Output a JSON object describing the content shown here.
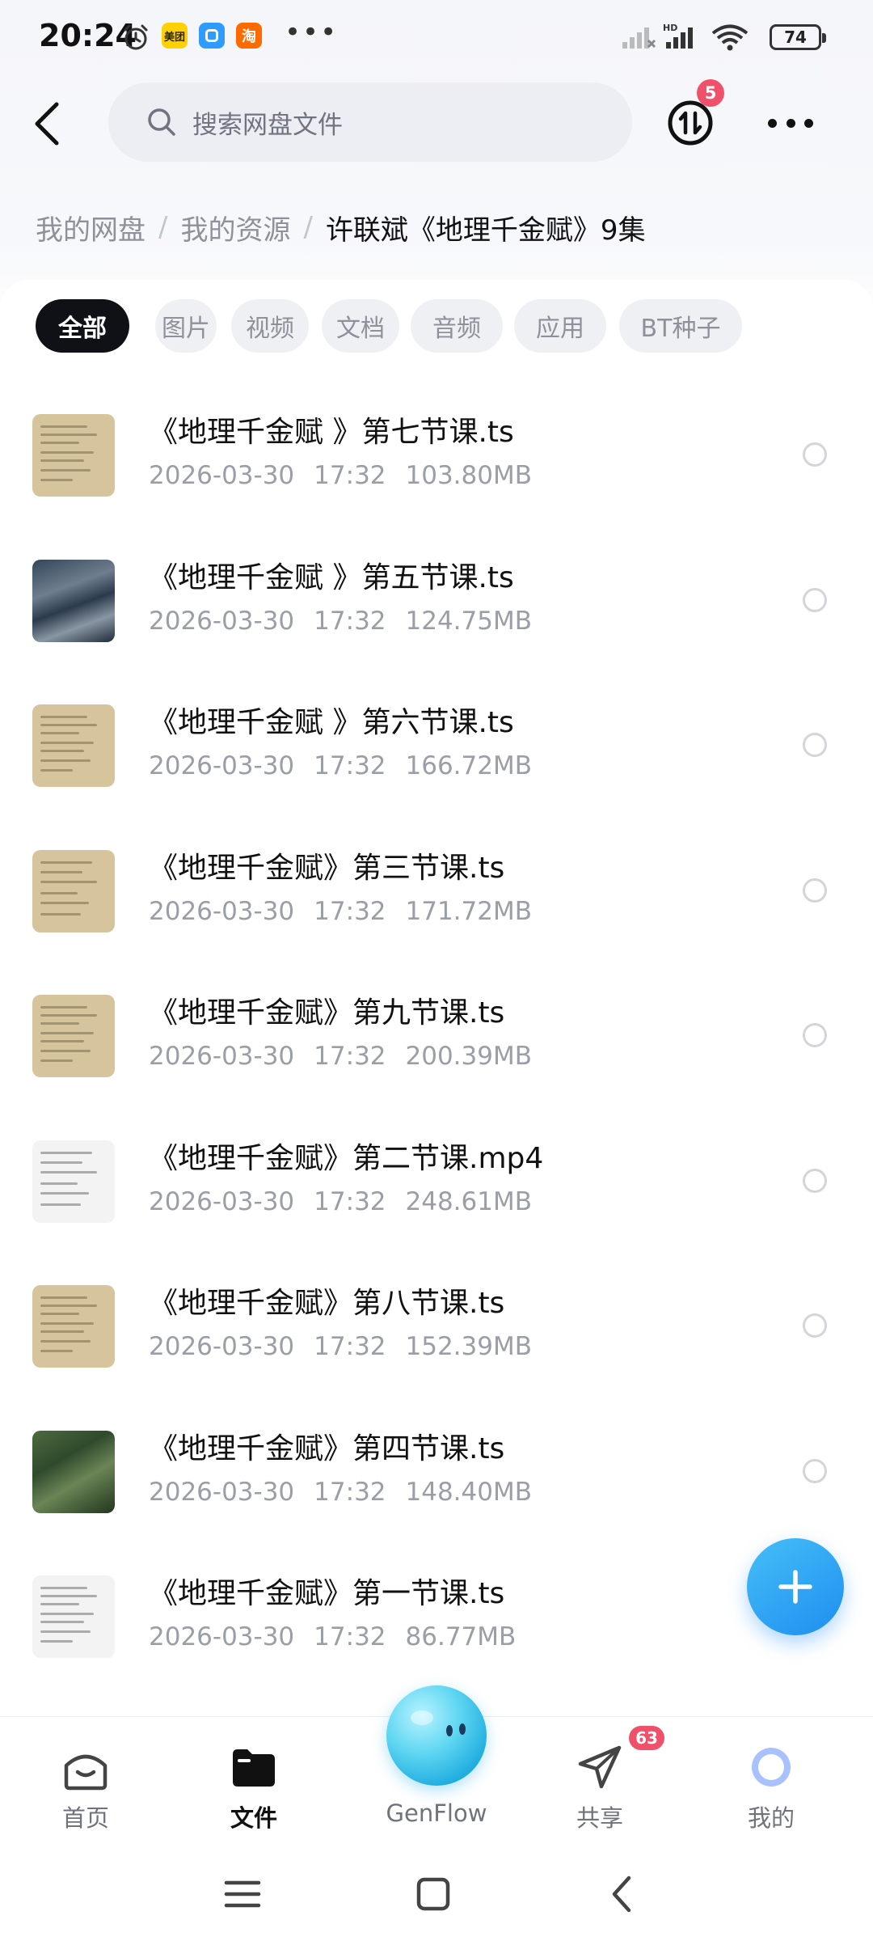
{
  "status_bar": {
    "time": "20:24",
    "apps": [
      {
        "name": "meituan",
        "label": "美团",
        "color": "#ffd100"
      },
      {
        "name": "app-blue",
        "label": "",
        "color": "#2f9bff"
      },
      {
        "name": "taobao",
        "label": "淘",
        "color": "#ff6a00"
      }
    ],
    "dots": "•••",
    "battery": "74"
  },
  "header": {
    "search_placeholder": "搜索网盘文件",
    "transfer_badge": "5"
  },
  "breadcrumb": {
    "items": [
      "我的网盘",
      "我的资源"
    ],
    "current": "许联斌《地理千金赋》9集",
    "separator": "/"
  },
  "filters": {
    "chips": [
      "全部",
      "图片",
      "视频",
      "文档",
      "音频",
      "应用",
      "BT种子"
    ],
    "active_index": 0
  },
  "files": [
    {
      "name": "《地理千金赋 》第七节课.ts",
      "date": "2026-03-30",
      "time": "17:32",
      "size": "103.80MB",
      "thumb": "paper"
    },
    {
      "name": "《地理千金赋 》第五节课.ts",
      "date": "2026-03-30",
      "time": "17:32",
      "size": "124.75MB",
      "thumb": "aerial"
    },
    {
      "name": "《地理千金赋 》第六节课.ts",
      "date": "2026-03-30",
      "time": "17:32",
      "size": "166.72MB",
      "thumb": "paper"
    },
    {
      "name": "《地理千金赋》第三节课.ts",
      "date": "2026-03-30",
      "time": "17:32",
      "size": "171.72MB",
      "thumb": "paper"
    },
    {
      "name": "《地理千金赋》第九节课.ts",
      "date": "2026-03-30",
      "time": "17:32",
      "size": "200.39MB",
      "thumb": "paper"
    },
    {
      "name": "《地理千金赋》第二节课.mp4",
      "date": "2026-03-30",
      "time": "17:32",
      "size": "248.61MB",
      "thumb": "white"
    },
    {
      "name": "《地理千金赋》第八节课.ts",
      "date": "2026-03-30",
      "time": "17:32",
      "size": "152.39MB",
      "thumb": "paper"
    },
    {
      "name": "《地理千金赋》第四节课.ts",
      "date": "2026-03-30",
      "time": "17:32",
      "size": "148.40MB",
      "thumb": "green"
    },
    {
      "name": "《地理千金赋》第一节课.ts",
      "date": "2026-03-30",
      "time": "17:32",
      "size": "86.77MB",
      "thumb": "white"
    }
  ],
  "bottom_nav": {
    "items": [
      {
        "label": "首页",
        "icon": "home-icon"
      },
      {
        "label": "文件",
        "icon": "folder-icon"
      },
      {
        "label": "GenFlow",
        "icon": "genflow-orb-icon"
      },
      {
        "label": "共享",
        "icon": "send-icon"
      },
      {
        "label": "我的",
        "icon": "profile-icon"
      }
    ],
    "active_index": 1,
    "share_badge": "63"
  },
  "colors": {
    "accent": "#1e8ef0",
    "badge": "#f0506a",
    "chip_active_bg": "#0f1117",
    "chip_bg": "#eff0f4"
  }
}
